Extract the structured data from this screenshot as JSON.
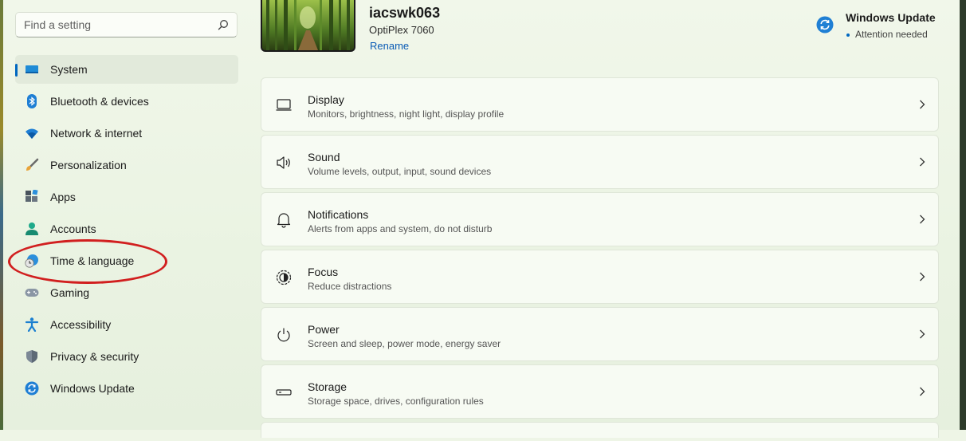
{
  "search": {
    "placeholder": "Find a setting",
    "icon": "search-icon"
  },
  "sidebar": {
    "items": [
      {
        "label": "System",
        "icon": "system-icon",
        "active": true
      },
      {
        "label": "Bluetooth & devices",
        "icon": "bluetooth-icon"
      },
      {
        "label": "Network & internet",
        "icon": "wifi-icon"
      },
      {
        "label": "Personalization",
        "icon": "brush-icon"
      },
      {
        "label": "Apps",
        "icon": "apps-icon"
      },
      {
        "label": "Accounts",
        "icon": "accounts-icon"
      },
      {
        "label": "Time & language",
        "icon": "time-language-icon"
      },
      {
        "label": "Gaming",
        "icon": "gamepad-icon"
      },
      {
        "label": "Accessibility",
        "icon": "accessibility-icon"
      },
      {
        "label": "Privacy & security",
        "icon": "shield-icon"
      },
      {
        "label": "Windows Update",
        "icon": "update-icon"
      }
    ]
  },
  "device": {
    "name": "iacswk063",
    "model": "OptiPlex 7060",
    "rename_label": "Rename"
  },
  "windows_update": {
    "title": "Windows Update",
    "status": "Attention needed"
  },
  "cards": [
    {
      "title": "Display",
      "subtitle": "Monitors, brightness, night light, display profile",
      "icon": "display-icon"
    },
    {
      "title": "Sound",
      "subtitle": "Volume levels, output, input, sound devices",
      "icon": "speaker-icon"
    },
    {
      "title": "Notifications",
      "subtitle": "Alerts from apps and system, do not disturb",
      "icon": "bell-icon"
    },
    {
      "title": "Focus",
      "subtitle": "Reduce distractions",
      "icon": "focus-icon"
    },
    {
      "title": "Power",
      "subtitle": "Screen and sleep, power mode, energy saver",
      "icon": "power-icon"
    },
    {
      "title": "Storage",
      "subtitle": "Storage space, drives, configuration rules",
      "icon": "storage-icon"
    }
  ],
  "colors": {
    "accent": "#0067c0",
    "annotation": "#d11f1f"
  }
}
